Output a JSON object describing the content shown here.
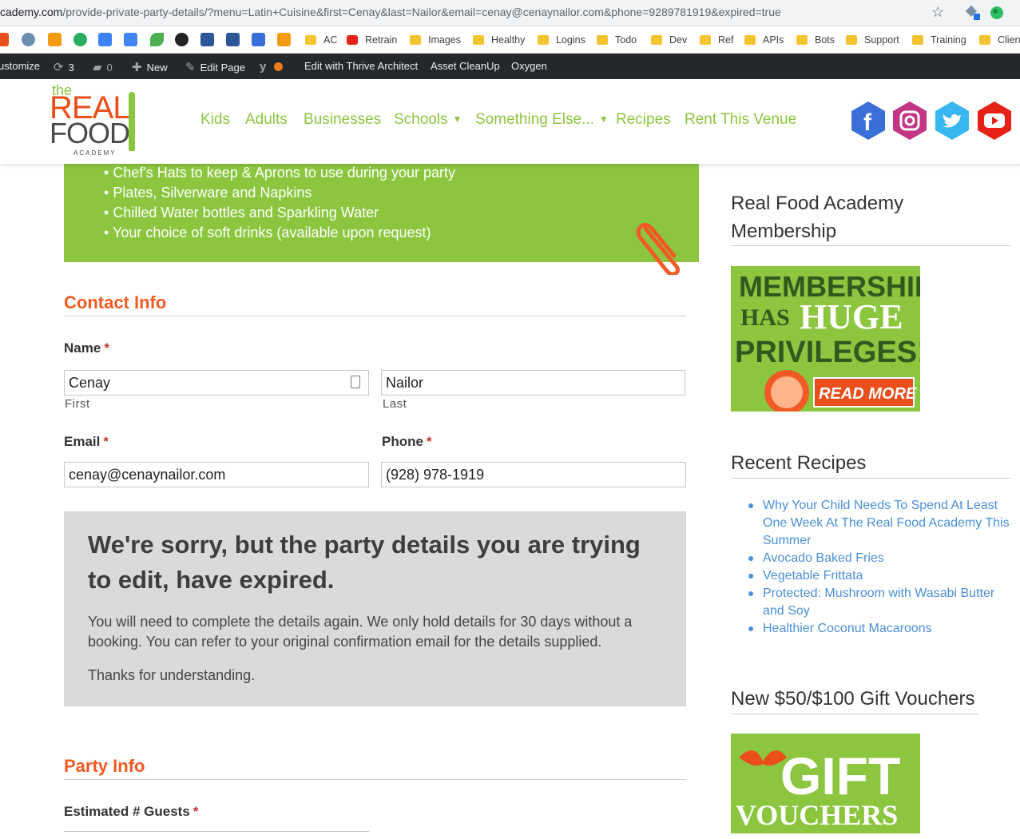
{
  "browser": {
    "url_host": "cademy.com",
    "url_path": "/provide-private-party-details/?menu=Latin+Cuisine&first=Cenay&last=Nailor&email=cenay@cenaynailor.com&phone=9289781919&expired=true",
    "bookmarks": [
      "AC",
      "Retrain",
      "Images",
      "Healthy",
      "Logins",
      "Todo",
      "Dev",
      "Ref",
      "APIs",
      "Bots",
      "Support",
      "Training",
      "Client"
    ]
  },
  "wp_admin": {
    "customize": "ustomize",
    "updates": "3",
    "comments": "0",
    "new": "New",
    "edit_page": "Edit Page",
    "thrive": "Edit with Thrive Architect",
    "asset_cleanup": "Asset CleanUp",
    "oxygen": "Oxygen"
  },
  "logo": {
    "the": "the",
    "real": "REAL",
    "food": "FOOD",
    "academy": "ACADEMY"
  },
  "nav": [
    "Kids",
    "Adults",
    "Businesses",
    "Schools",
    "Something Else...",
    "Recipes",
    "Rent This Venue"
  ],
  "social": [
    "facebook-icon",
    "instagram-icon",
    "twitter-icon",
    "youtube-icon"
  ],
  "inclusions": [
    "Chef's Hats to keep & Aprons to use during your party",
    "Plates, Silverware and Napkins",
    "Chilled Water bottles and Sparkling Water",
    "Your choice of soft drinks (available upon request)"
  ],
  "contact": {
    "title": "Contact Info",
    "name_label": "Name",
    "first_value": "Cenay",
    "first_sub": "First",
    "last_value": "Nailor",
    "last_sub": "Last",
    "email_label": "Email",
    "email_value": "cenay@cenaynailor.com",
    "phone_label": "Phone",
    "phone_value": "(928) 978-1919",
    "required_mark": "*"
  },
  "notice": {
    "heading": "We're sorry, but the party details you are trying to edit, have expired.",
    "body": "You will need to complete the details again. We only hold details for 30 days without a booking. You can refer to your original confirmation email for the details supplied.",
    "thanks": "Thanks for understanding."
  },
  "party": {
    "title": "Party Info",
    "guests_label": "Estimated # Guests"
  },
  "sidebar": {
    "membership_title": "Real Food Academy Membership",
    "membership_banner": {
      "line1": "MEMBERSHIP",
      "has": "HAS",
      "huge": "HUGE",
      "line3": "PRIVILEGES!",
      "cta": "READ MORE >"
    },
    "recipes_title": "Recent Recipes",
    "recipes": [
      "Why Your Child Needs To Spend At Least One Week At The Real Food Academy This Summer",
      "Avocado Baked Fries",
      "Vegetable Frittata",
      "Protected: Mushroom with Wasabi Butter and Soy",
      "Healthier Coconut Macaroons"
    ],
    "vouchers_title": "New $50/$100 Gift Vouchers",
    "vouchers_banner": {
      "line1": "GIFT",
      "line2": "VOUCHERS"
    }
  },
  "colors": {
    "green": "#8cc63f",
    "orange": "#f15a24",
    "link": "#4a90d9",
    "wpbar": "#23282d"
  }
}
